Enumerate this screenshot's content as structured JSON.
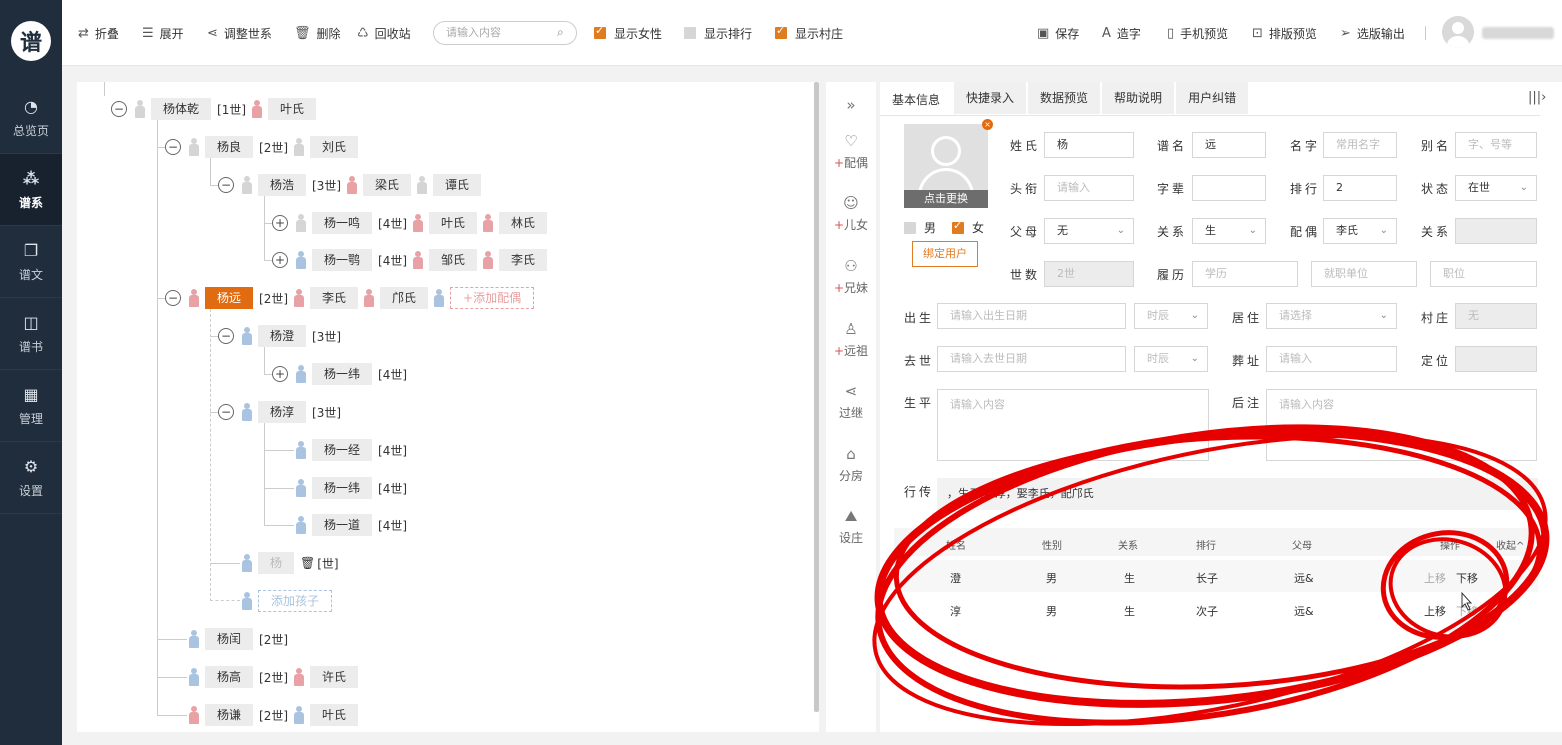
{
  "nav": {
    "logo": "谱",
    "items": [
      {
        "label": "总览页",
        "icon": "pie-chart-icon"
      },
      {
        "label": "谱系",
        "icon": "tree-icon"
      },
      {
        "label": "谱文",
        "icon": "document-icon"
      },
      {
        "label": "谱书",
        "icon": "book-icon"
      },
      {
        "label": "管理",
        "icon": "grid-icon"
      },
      {
        "label": "设置",
        "icon": "gear-icon"
      }
    ],
    "active_index": 1
  },
  "toolbar": {
    "fold": "折叠",
    "expand": "展开",
    "adjust": "调整世系",
    "delete": "删除",
    "recycle": "回收站",
    "search_placeholder": "请输入内容",
    "show_female": "显示女性",
    "show_rank": "显示排行",
    "show_village": "显示村庄",
    "save": "保存",
    "create_char": "造字",
    "mobile_preview": "手机预览",
    "layout_preview": "排版预览",
    "export": "选版输出"
  },
  "tree": {
    "root": {
      "name": "杨体乾",
      "gen": "[1世]",
      "spouse": "叶氏"
    },
    "n1": {
      "name": "杨良",
      "gen": "[2世]",
      "spouse": "刘氏"
    },
    "n2": {
      "name": "杨浩",
      "gen": "[3世]",
      "spouses": [
        "梁氏",
        "谭氏"
      ]
    },
    "n3": {
      "name": "杨一鸣",
      "gen": "[4世]",
      "spouses": [
        "叶氏",
        "林氏"
      ]
    },
    "n4": {
      "name": "杨一鹗",
      "gen": "[4世]",
      "spouses": [
        "邹氏",
        "李氏"
      ]
    },
    "n5": {
      "name": "杨远",
      "gen": "[2世]",
      "spouses": [
        "李氏",
        "邝氏"
      ],
      "add_spouse": "+添加配偶"
    },
    "n6": {
      "name": "杨澄",
      "gen": "[3世]"
    },
    "n7": {
      "name": "杨一纬",
      "gen": "[4世]"
    },
    "n8": {
      "name": "杨淳",
      "gen": "[3世]"
    },
    "n9": {
      "name": "杨一经",
      "gen": "[4世]"
    },
    "n10": {
      "name": "杨一纬",
      "gen": "[4世]"
    },
    "n11": {
      "name": "杨一道",
      "gen": "[4世]"
    },
    "n12": {
      "name": "杨",
      "gen": "[世]"
    },
    "add_child": "添加孩子",
    "n13": {
      "name": "杨闰",
      "gen": "[2世]"
    },
    "n14": {
      "name": "杨高",
      "gen": "[2世]",
      "spouse": "许氏"
    },
    "n15": {
      "name": "杨谦",
      "gen": "[2世]",
      "spouse": "叶氏"
    }
  },
  "midbar": [
    {
      "label": "配偶",
      "plus": "+"
    },
    {
      "label": "儿女",
      "plus": "+"
    },
    {
      "label": "兄妹",
      "plus": "+"
    },
    {
      "label": "远祖",
      "plus": "+"
    },
    {
      "label": "过继",
      "plus": ""
    },
    {
      "label": "分房",
      "plus": ""
    },
    {
      "label": "设庄",
      "plus": ""
    }
  ],
  "form": {
    "tabs": [
      "基本信息",
      "快捷录入",
      "数据预览",
      "帮助说明",
      "用户纠错"
    ],
    "photo_caption": "点击更换",
    "gender_male": "男",
    "gender_female": "女",
    "bind_user": "绑定用户",
    "labels": {
      "surname": "姓氏",
      "pu_name": "谱名",
      "given_name": "名字",
      "alias": "别名",
      "title": "头衔",
      "generation_char": "字辈",
      "rank": "排行",
      "status": "状态",
      "parents": "父母",
      "relation": "关系",
      "spouse": "配偶",
      "relation2": "关系",
      "gen_count": "世数",
      "resume": "履历",
      "birth": "出生",
      "residence": "居住",
      "village": "村庄",
      "death": "去世",
      "burial": "葬址",
      "locate": "定位",
      "life": "生平",
      "note": "后注",
      "xingzhuan": "行传"
    },
    "values": {
      "surname": "杨",
      "pu_name": "远",
      "given_name_ph": "常用名字",
      "alias_ph": "字、号等",
      "title_ph": "请输入",
      "generation_char": "",
      "rank": "2",
      "status": "在世",
      "parents": "无",
      "relation": "生",
      "spouse": "李氏",
      "gen_count": "2世",
      "edu_ph": "学历",
      "work_ph": "就职单位",
      "post_ph": "职位",
      "birth_ph": "请输入出生日期",
      "birth_hour": "时辰",
      "residence_ph": "请选择",
      "village": "无",
      "death_ph": "请输入去世日期",
      "death_hour": "时辰",
      "burial_ph": "请输入",
      "life_ph": "请输入内容",
      "note_ph": "请输入内容",
      "xingzhuan": "，生子澄/淳，娶李氏，配邝氏"
    },
    "table": {
      "headers": [
        "姓名",
        "性别",
        "关系",
        "排行",
        "父母",
        "操作",
        "收起"
      ],
      "rows": [
        {
          "name": "澄",
          "sex": "男",
          "rel": "生",
          "rank": "长子",
          "parent": "远&",
          "up": "上移",
          "down": "下移"
        },
        {
          "name": "淳",
          "sex": "男",
          "rel": "生",
          "rank": "次子",
          "parent": "远&",
          "up": "上移",
          "down": "下移"
        }
      ]
    }
  },
  "colors": {
    "accent": "#e06b10",
    "nav_bg": "#1f2d3d",
    "annotation": "#e60000"
  }
}
